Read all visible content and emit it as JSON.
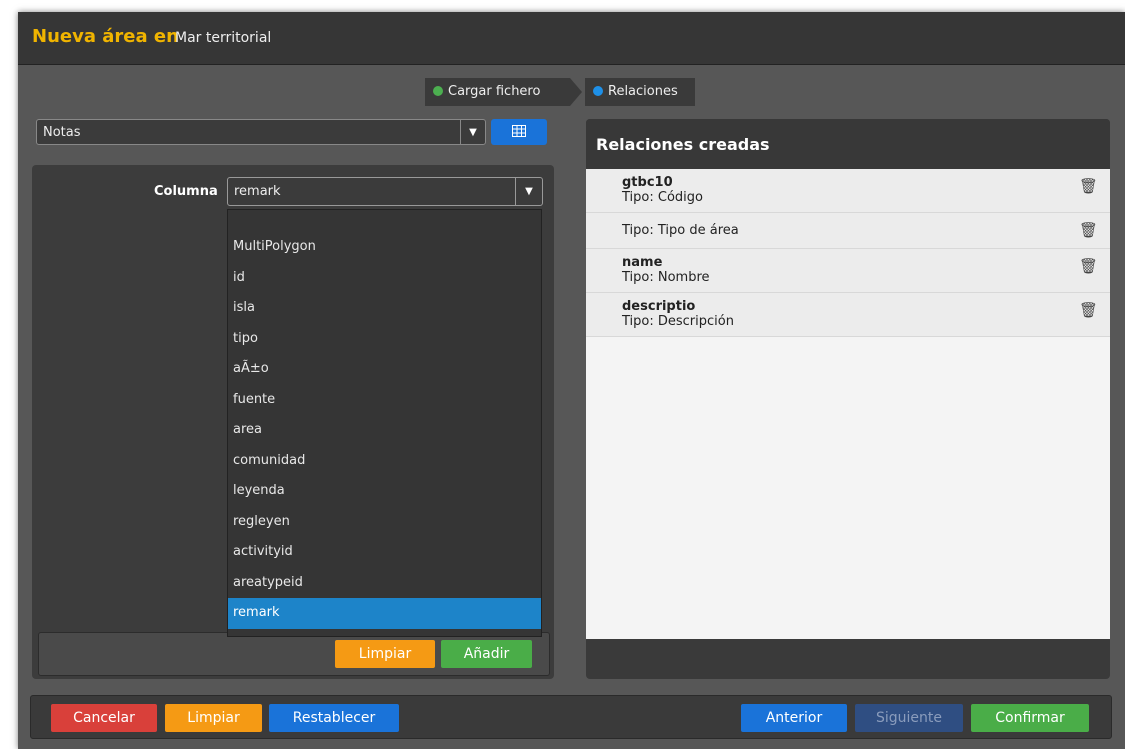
{
  "title": {
    "main": "Nueva área en",
    "sub": "Mar territorial"
  },
  "steps": [
    {
      "label": "Cargar fichero",
      "color": "#4caf50"
    },
    {
      "label": "Relaciones",
      "color": "#1e90e8"
    }
  ],
  "notas_select": {
    "value": "Notas"
  },
  "columna": {
    "label": "Columna",
    "value": "remark",
    "options": [
      "",
      "MultiPolygon",
      "id",
      "isla",
      "tipo",
      "aÃ±o",
      "fuente",
      "area",
      "comunidad",
      "leyenda",
      "regleyen",
      "activityid",
      "areatypeid",
      "remark"
    ]
  },
  "left_buttons": {
    "limpiar": "Limpiar",
    "anadir": "Añadir"
  },
  "relations": {
    "title": "Relaciones creadas",
    "items": [
      {
        "name": "gtbc10",
        "type": "Tipo: Código"
      },
      {
        "name": "",
        "type": "Tipo: Tipo de área"
      },
      {
        "name": "name",
        "type": "Tipo: Nombre"
      },
      {
        "name": "descriptio",
        "type": "Tipo: Descripción"
      }
    ]
  },
  "footer": {
    "cancelar": "Cancelar",
    "limpiar": "Limpiar",
    "restablecer": "Restablecer",
    "anterior": "Anterior",
    "siguiente": "Siguiente",
    "confirmar": "Confirmar"
  },
  "icons": {
    "caret": "caret-down-icon",
    "grid": "table-grid-icon",
    "trash": "trash-icon"
  }
}
